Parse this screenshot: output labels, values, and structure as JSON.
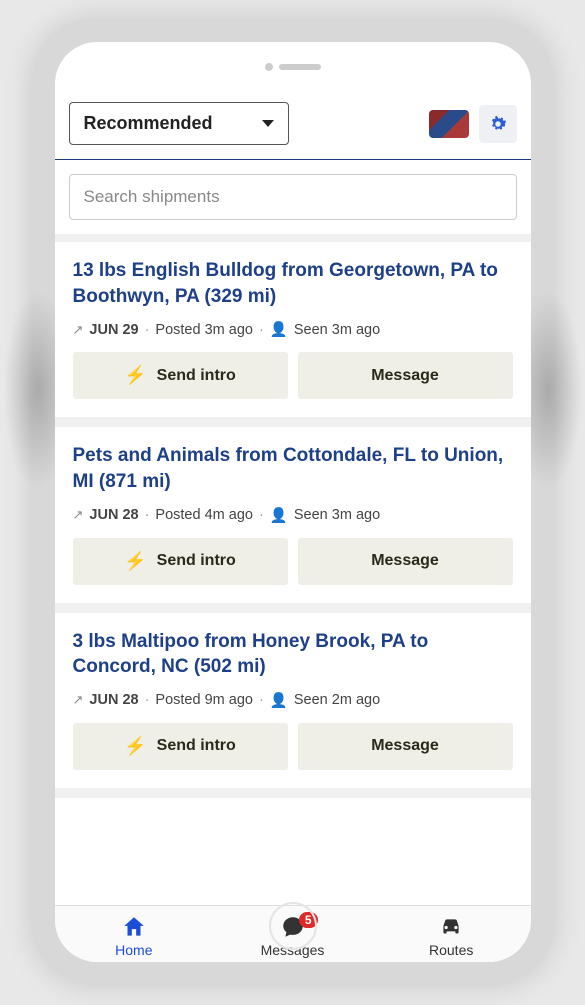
{
  "header": {
    "sort_label": "Recommended",
    "search_placeholder": "Search shipments"
  },
  "cards": [
    {
      "title": "13 lbs English Bulldog from Georgetown, PA to Boothwyn, PA (329 mi)",
      "date": "JUN 29",
      "posted": "Posted 3m ago",
      "seen": "Seen 3m ago",
      "intro_label": "Send intro",
      "message_label": "Message"
    },
    {
      "title": "Pets and Animals from Cottondale, FL to Union, MI (871 mi)",
      "date": "JUN 28",
      "posted": "Posted 4m ago",
      "seen": "Seen 3m ago",
      "intro_label": "Send intro",
      "message_label": "Message"
    },
    {
      "title": "3 lbs Maltipoo from Honey Brook, PA to Concord, NC (502 mi)",
      "date": "JUN 28",
      "posted": "Posted 9m ago",
      "seen": "Seen 2m ago",
      "intro_label": "Send intro",
      "message_label": "Message"
    }
  ],
  "nav": {
    "home": "Home",
    "messages": "Messages",
    "messages_badge": "5",
    "routes": "Routes"
  }
}
